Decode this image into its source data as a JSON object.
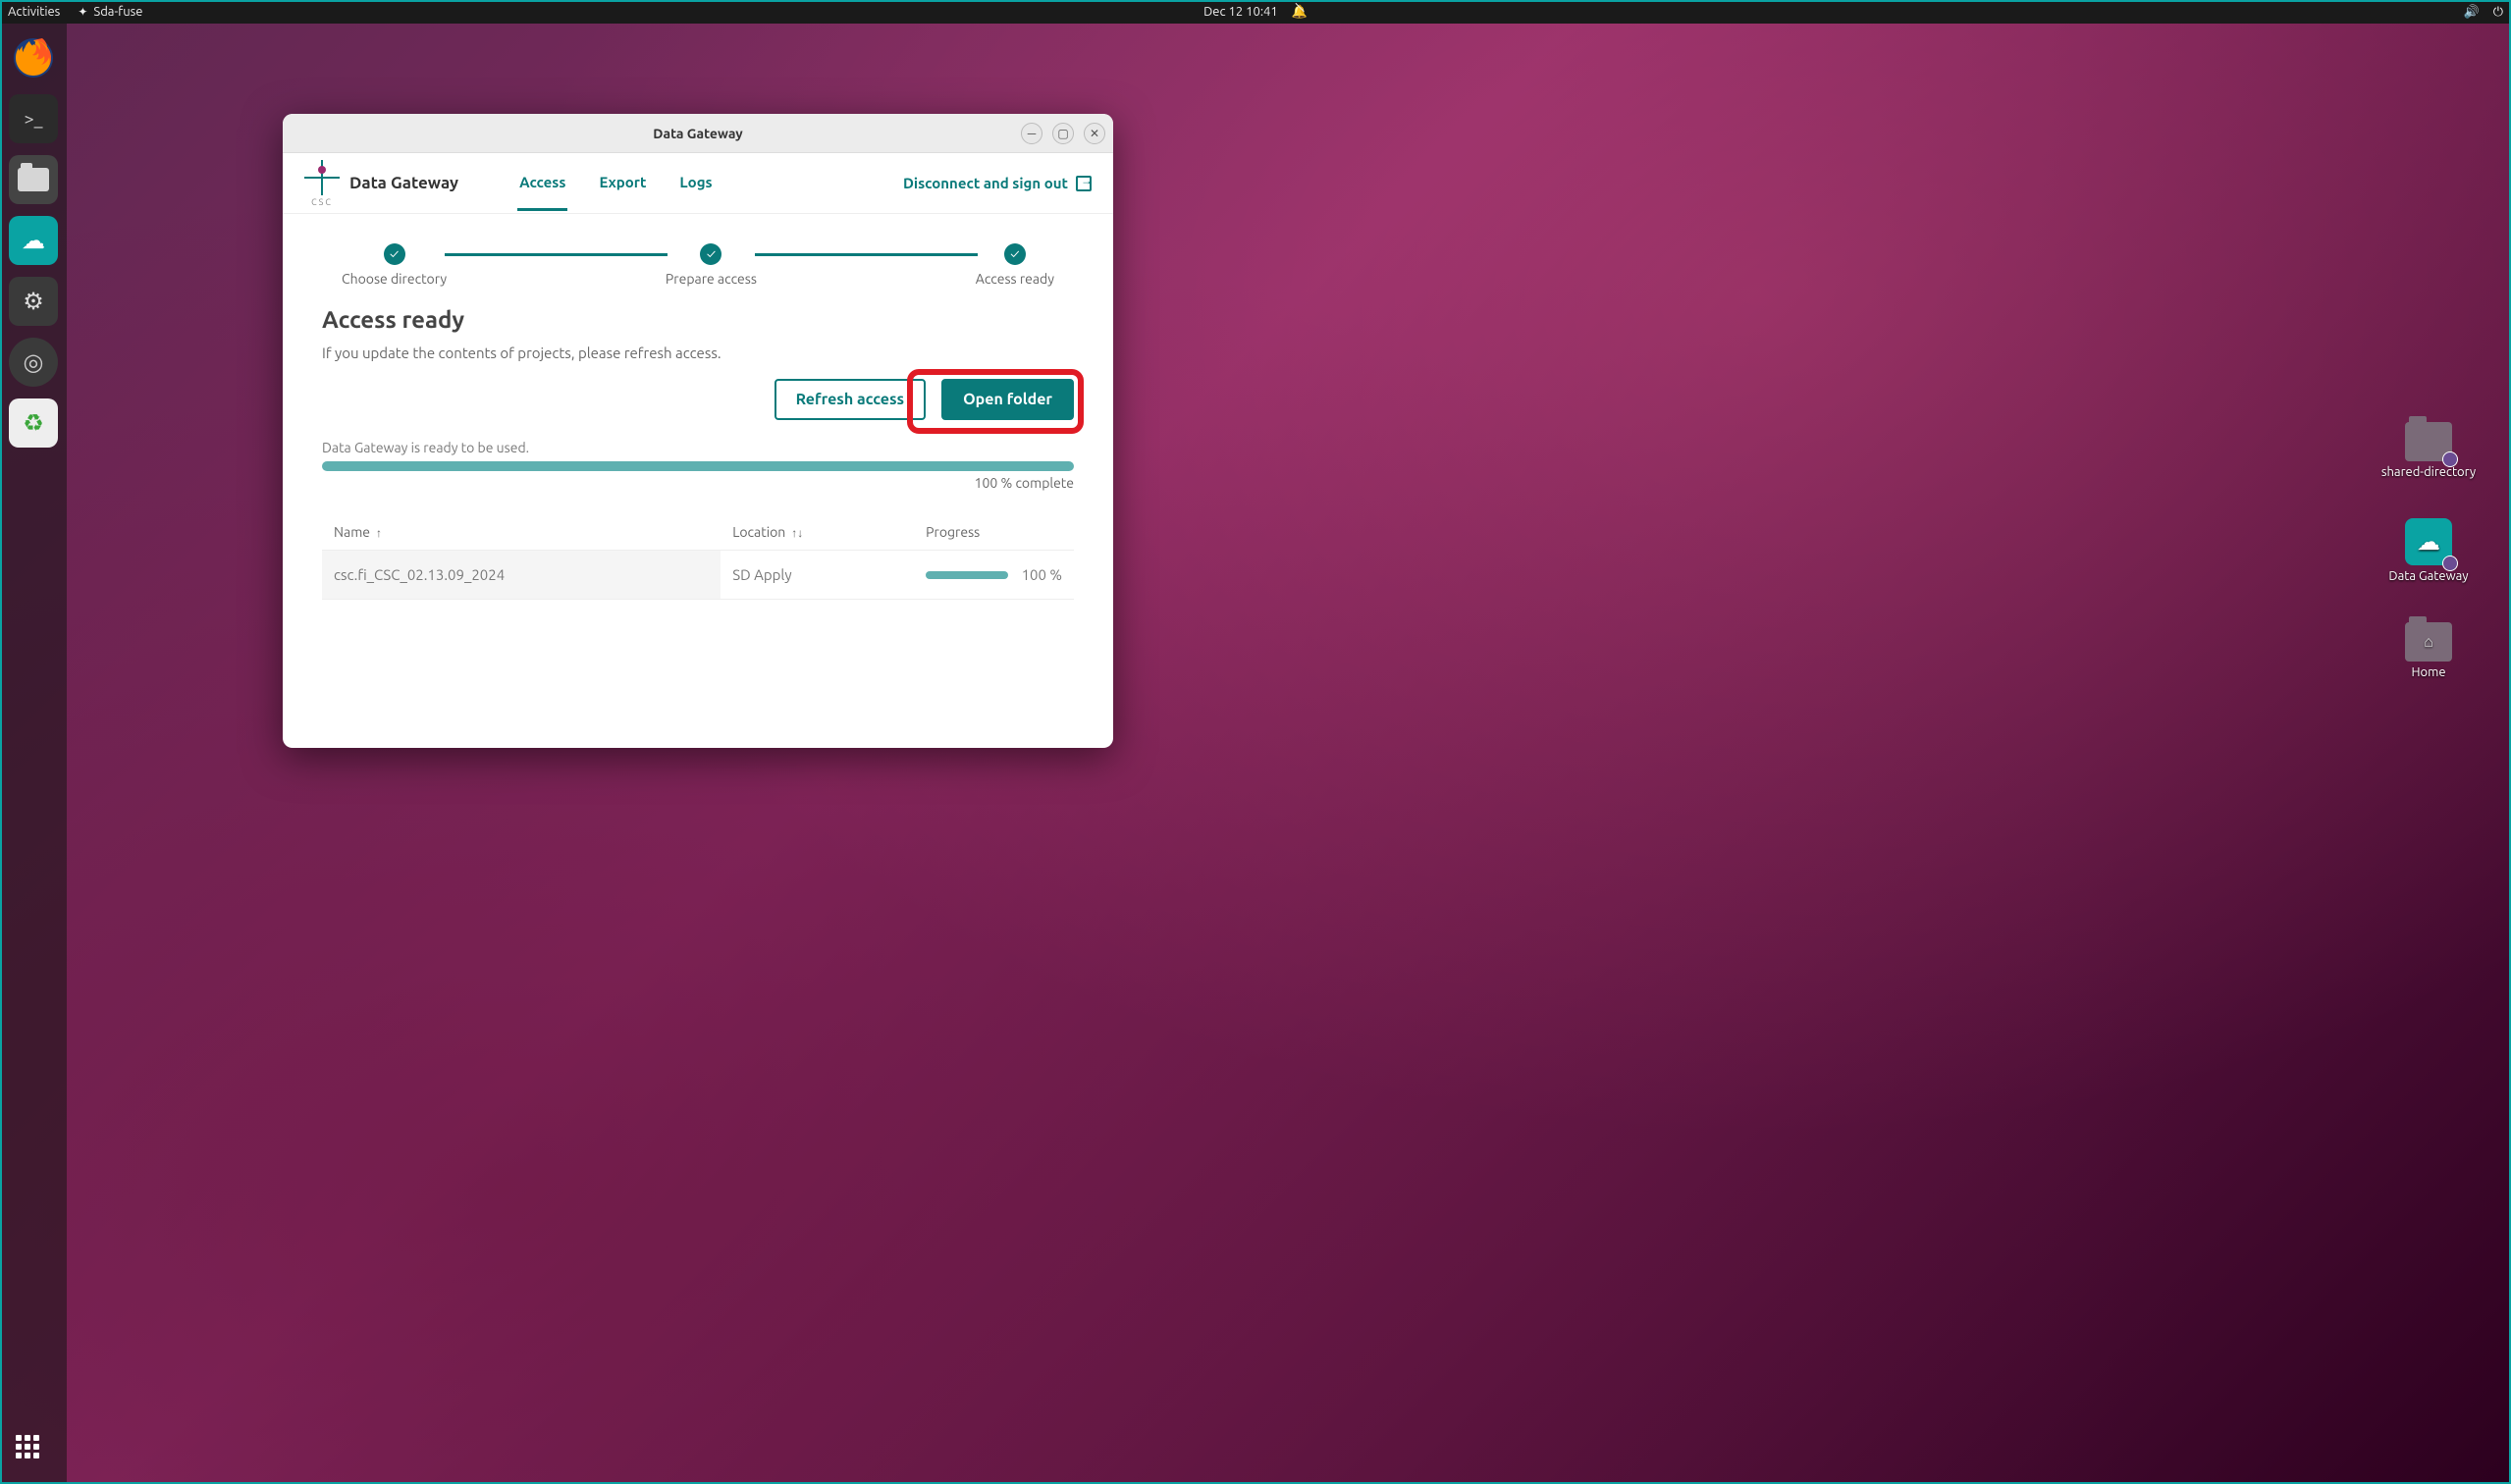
{
  "topbar": {
    "activities": "Activities",
    "app_name": "Sda-fuse",
    "datetime": "Dec 12  10:41"
  },
  "dock": {
    "items": [
      {
        "name": "firefox"
      },
      {
        "name": "terminal"
      },
      {
        "name": "files"
      },
      {
        "name": "data-gateway"
      },
      {
        "name": "settings"
      },
      {
        "name": "disks"
      },
      {
        "name": "trash"
      }
    ]
  },
  "desktop": {
    "icons": [
      {
        "label": "shared-directory"
      },
      {
        "label": "Data Gateway"
      },
      {
        "label": "Home"
      }
    ]
  },
  "window": {
    "title": "Data Gateway",
    "logo_text": "Data Gateway",
    "logo_sub": "CSC",
    "tabs": [
      {
        "label": "Access",
        "active": true
      },
      {
        "label": "Export",
        "active": false
      },
      {
        "label": "Logs",
        "active": false
      }
    ],
    "signout": "Disconnect and sign out",
    "steps": [
      {
        "label": "Choose directory"
      },
      {
        "label": "Prepare access"
      },
      {
        "label": "Access ready"
      }
    ],
    "heading": "Access ready",
    "subtext": "If you update the contents of projects, please refresh access.",
    "buttons": {
      "refresh": "Refresh access",
      "open": "Open folder"
    },
    "status": "Data Gateway is ready to be used.",
    "progress_pct": 100,
    "progress_label": "100 % complete",
    "table": {
      "headers": {
        "name": "Name",
        "location": "Location",
        "progress": "Progress"
      },
      "rows": [
        {
          "name": "csc.fi_CSC_02.13.09_2024",
          "location": "SD Apply",
          "progress": "100 %"
        }
      ]
    }
  }
}
